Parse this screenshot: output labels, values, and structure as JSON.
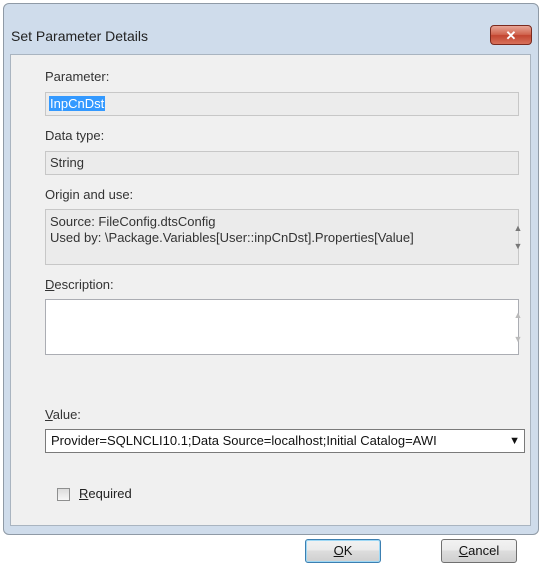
{
  "dialog": {
    "title": "Set Parameter Details",
    "close_glyph": "✕"
  },
  "parameter": {
    "label": "Parameter:",
    "value": "InpCnDst"
  },
  "data_type": {
    "label": "Data type:",
    "value": "String"
  },
  "origin": {
    "label": "Origin and use:",
    "line1": "Source: FileConfig.dtsConfig",
    "line2": "Used by: \\Package.Variables[User::inpCnDst].Properties[Value]"
  },
  "description": {
    "label_first": "D",
    "label_rest": "escription:",
    "value": ""
  },
  "value": {
    "label_first": "V",
    "label_rest": "alue:",
    "selected": "Provider=SQLNCLI10.1;Data Source=localhost;Initial Catalog=AWI"
  },
  "required": {
    "label_first": "R",
    "label_rest": "equired",
    "checked": false
  },
  "buttons": {
    "ok_first": "O",
    "ok_rest": "K",
    "cancel_first": "C",
    "cancel_rest": "ancel"
  },
  "icons": {
    "scroll_up": "▲",
    "scroll_down": "▼",
    "dropdown": "▼"
  }
}
